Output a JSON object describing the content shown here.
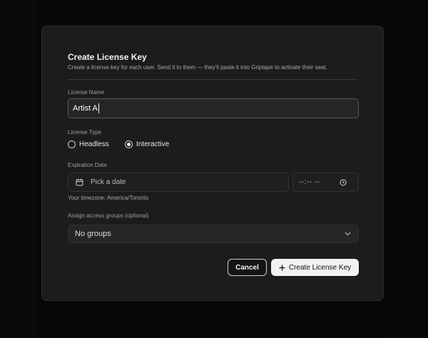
{
  "dialog": {
    "title": "Create License Key",
    "subtitle": "Create a license key for each user. Send it to them — they'll paste it into Griptape to activate their seat."
  },
  "license_name": {
    "label": "License Name",
    "value": "Artist A"
  },
  "license_type": {
    "label": "License Type",
    "options": [
      {
        "label": "Headless",
        "selected": false
      },
      {
        "label": "Interactive",
        "selected": true
      }
    ]
  },
  "expiration": {
    "label": "Expiration Date",
    "date_placeholder": "Pick a date",
    "time_placeholder": "--:-- --",
    "timezone_text": "Your timezone: America/Toronto"
  },
  "access_groups": {
    "label": "Assign access groups (optional)",
    "selected": "No groups"
  },
  "actions": {
    "cancel_label": "Cancel",
    "create_label": "Create License Key"
  },
  "icons": {
    "date": "calendar-icon",
    "time": "clock-icon",
    "select": "chevron-down-icon",
    "create": "plus-icon"
  },
  "colors": {
    "modal_bg": "#1c1c1c",
    "primary_button_bg": "#f2f2f2",
    "page_bg": "#0b0b0b"
  }
}
